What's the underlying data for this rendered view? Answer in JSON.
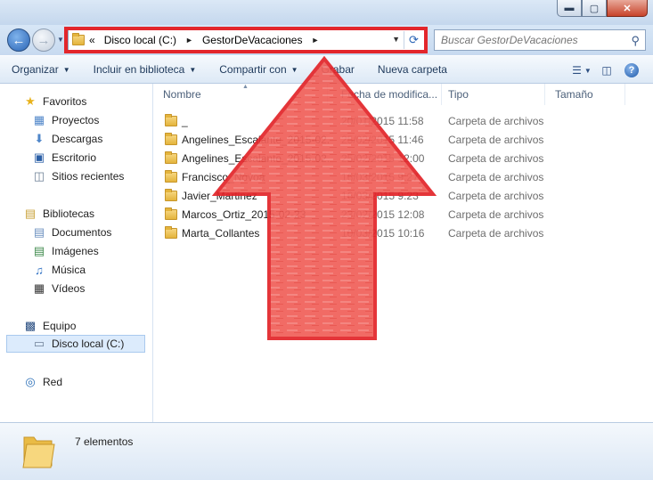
{
  "window": {
    "minimize_glyph": "▬",
    "maximize_glyph": "▢",
    "close_glyph": "✕"
  },
  "address_bar": {
    "overflow_glyph": "«",
    "crumbs": [
      "Disco local (C:)",
      "GestorDeVacaciones"
    ],
    "separator_glyph": "►",
    "dropdown_glyph": "▼",
    "refresh_glyph": "⟳"
  },
  "search": {
    "placeholder": "Buscar GestorDeVacaciones",
    "icon": "search-icon"
  },
  "toolbar": {
    "organizar": "Organizar",
    "incluir": "Incluir en biblioteca",
    "compartir": "Compartir con",
    "grabar": "Grabar",
    "nueva_carpeta": "Nueva carpeta",
    "help_glyph": "?"
  },
  "nav": {
    "favoritos": "Favoritos",
    "proyectos": "Proyectos",
    "descargas": "Descargas",
    "escritorio": "Escritorio",
    "sitios": "Sitios recientes",
    "bibliotecas": "Bibliotecas",
    "documentos": "Documentos",
    "imagenes": "Imágenes",
    "musica": "Música",
    "videos": "Vídeos",
    "equipo": "Equipo",
    "disco": "Disco local (C:)",
    "red": "Red"
  },
  "columns": {
    "nombre": "Nombre",
    "fecha": "Fecha de modifica...",
    "tipo": "Tipo",
    "tamano": "Tamaño"
  },
  "files": [
    {
      "name": "_",
      "date": "20/01/2015 11:58",
      "type": "Carpeta de archivos"
    },
    {
      "name": "Angelines_Escalante_2015-02...",
      "date": "25/02/2015 11:46",
      "type": "Carpeta de archivos"
    },
    {
      "name": "Angelines_Escalante_2015-02...",
      "date": "25/02/2015 12:00",
      "type": "Carpeta de archivos"
    },
    {
      "name": "Francisco_Novoa",
      "date": "16/03/2015 9:27",
      "type": "Carpeta de archivos"
    },
    {
      "name": "Javier_Martinez",
      "date": "16/03/2015 9:23",
      "type": "Carpeta de archivos"
    },
    {
      "name": "Marcos_Ortiz_2015-02-23",
      "date": "23/02/2015 12:08",
      "type": "Carpeta de archivos"
    },
    {
      "name": "Marta_Collantes",
      "date": "10/03/2015 10:16",
      "type": "Carpeta de archivos"
    }
  ],
  "details": {
    "count": "7 elementos"
  },
  "colors": {
    "highlight_red": "#e3262b",
    "arrow_fill": "#f0605a"
  }
}
